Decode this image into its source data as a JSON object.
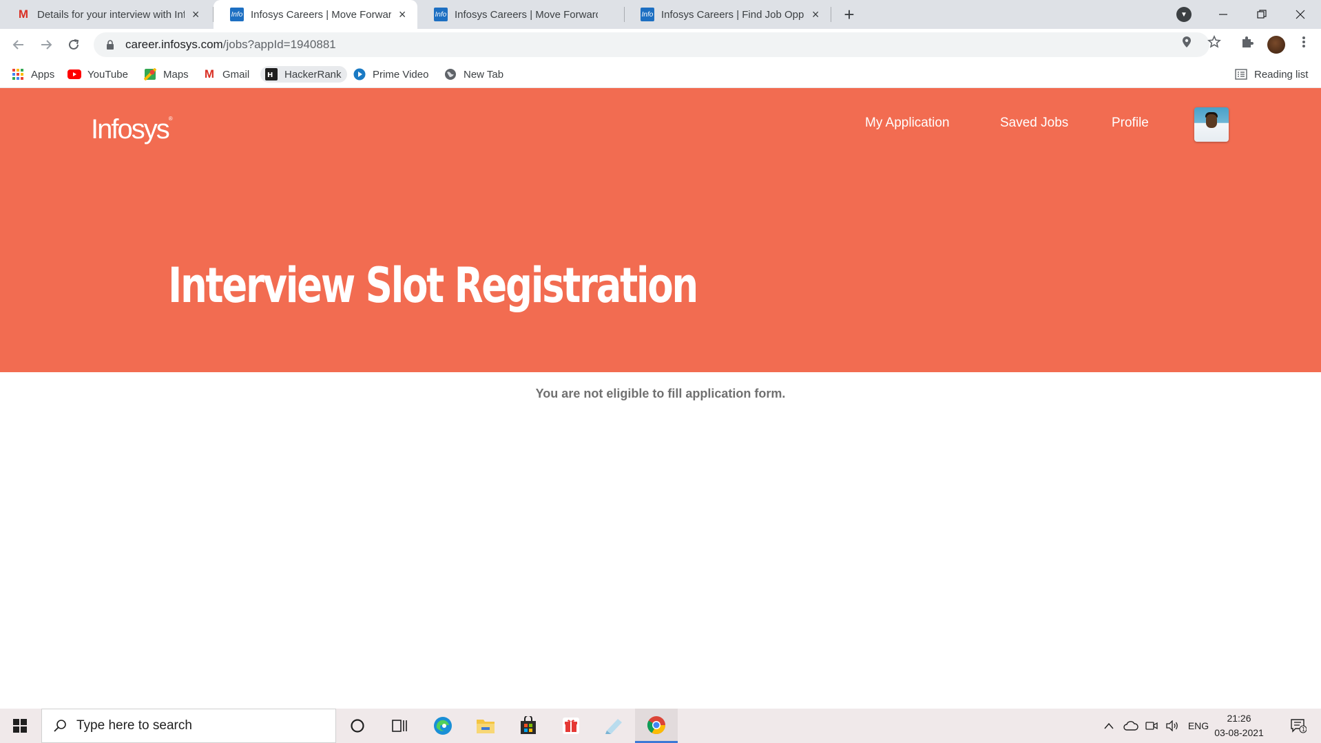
{
  "browser": {
    "tabs": [
      {
        "title": "Details for your interview with Infosys",
        "favicon": "gmail-icon",
        "active": false
      },
      {
        "title": "Infosys Careers | Move Forward. Together.",
        "favicon": "infosys-favicon-icon",
        "active": true
      },
      {
        "title": "Infosys Careers | Move Forward. Together.",
        "favicon": "infosys-favicon-icon",
        "active": false
      },
      {
        "title": "Infosys Careers | Find Job Opportunities",
        "favicon": "infosys-favicon-icon",
        "active": false
      }
    ],
    "favicon_text": "Info",
    "url_host": "career.infosys.com",
    "url_path": "/jobs?appId=1940881",
    "bookmarks": [
      "Apps",
      "YouTube",
      "Maps",
      "Gmail",
      "HackerRank",
      "Prime Video",
      "New Tab"
    ],
    "reading_list": "Reading list"
  },
  "site": {
    "logo": "Infosys",
    "logo_mark": "®",
    "nav": [
      "My Application",
      "Saved Jobs",
      "Profile"
    ],
    "hero_title": "Interview Slot Registration",
    "message": "You are not eligible to fill application form.",
    "brand_color": "#f26c51"
  },
  "taskbar": {
    "search_placeholder": "Type here to search",
    "language": "ENG",
    "time": "21:26",
    "date": "03-08-2021",
    "notification_count": "1"
  }
}
